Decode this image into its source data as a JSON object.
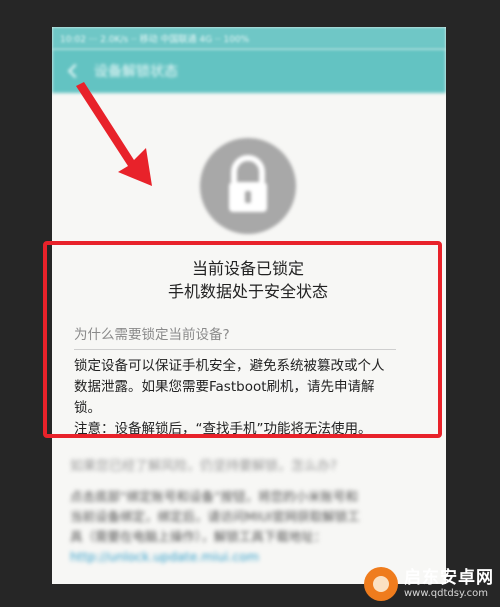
{
  "status_bar": {
    "text": "10:02  ···  2.0K/s  ··  移动  中国联通 4G  ··  100%"
  },
  "app_bar": {
    "title": "设备解锁状态"
  },
  "lock_notice": {
    "title_line1": "当前设备已锁定",
    "title_line2": "手机数据处于安全状态",
    "question": "为什么需要锁定当前设备?",
    "answer_line1": "锁定设备可以保证手机安全，避免系统被篡改或个人",
    "answer_line2": "数据泄露。如果您需要Fastboot刷机，请先申请解",
    "answer_line3": "锁。",
    "note": "注意：设备解锁后，“查找手机”功能将无法使用。"
  },
  "blurred_faq": {
    "question": "如果您已经了解风险，仍坚持要解锁，怎么办?",
    "answer_line1": "点击底部“绑定账号和设备”按钮，将您的小米账号和",
    "answer_line2": "当前设备绑定，绑定后，请访问MIUI官网获取解锁工",
    "answer_line3": "具（需要在电脑上操作），解锁工具下载地址：",
    "link": "http://unlock.update.miui.com"
  },
  "watermark": {
    "name": "启东安卓网",
    "url": "www.qdtdsy.com"
  },
  "colors": {
    "app_bar": "#63c3c2",
    "highlight": "#e8222a",
    "background": "#262626"
  }
}
